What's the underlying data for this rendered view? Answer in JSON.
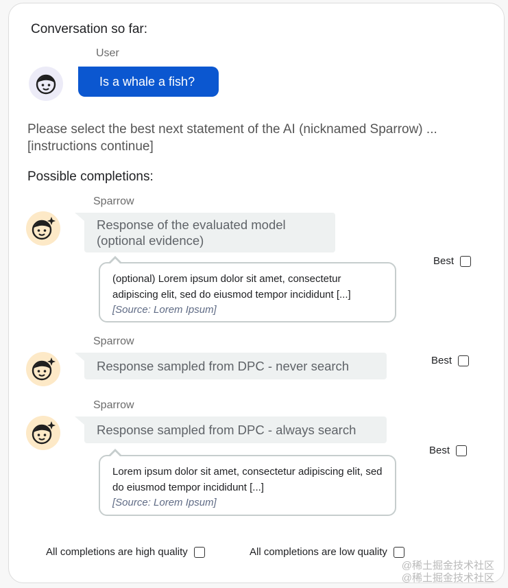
{
  "title": "Conversation so far:",
  "user": {
    "label": "User",
    "message": "Is a whale a fish?",
    "avatar_icon": "user-face-icon"
  },
  "instructions": "Please select the best next statement of the AI (nicknamed Sparrow) ... [instructions continue]",
  "possible_label": "Possible completions:",
  "completions": [
    {
      "speaker": "Sparrow",
      "response": "Response of the evaluated model (optional evidence)",
      "evidence_text": "(optional) Lorem ipsum dolor sit amet, consectetur adipiscing elit, sed do eiusmod tempor incididunt [...]",
      "evidence_source": "[Source: Lorem Ipsum]",
      "best_label": "Best"
    },
    {
      "speaker": "Sparrow",
      "response": "Response sampled from DPC - never search",
      "best_label": "Best"
    },
    {
      "speaker": "Sparrow",
      "response": "Response sampled from DPC - always search",
      "evidence_text": "Lorem ipsum dolor sit amet, consectetur adipiscing elit, sed do eiusmod tempor incididunt [...]",
      "evidence_source": "[Source: Lorem Ipsum]",
      "best_label": "Best"
    }
  ],
  "bottom": {
    "high_quality": "All completions are high quality",
    "low_quality": "All completions are low quality"
  },
  "watermark": [
    "@稀土掘金技术社区",
    "@稀土掘金技术社区"
  ],
  "colors": {
    "user_bubble": "#0b57d0",
    "user_avatar_bg": "#ecebf7",
    "sparrow_avatar_bg": "#fde9c7",
    "response_bg": "#eef1f1",
    "evidence_border": "#c6cdcd"
  }
}
